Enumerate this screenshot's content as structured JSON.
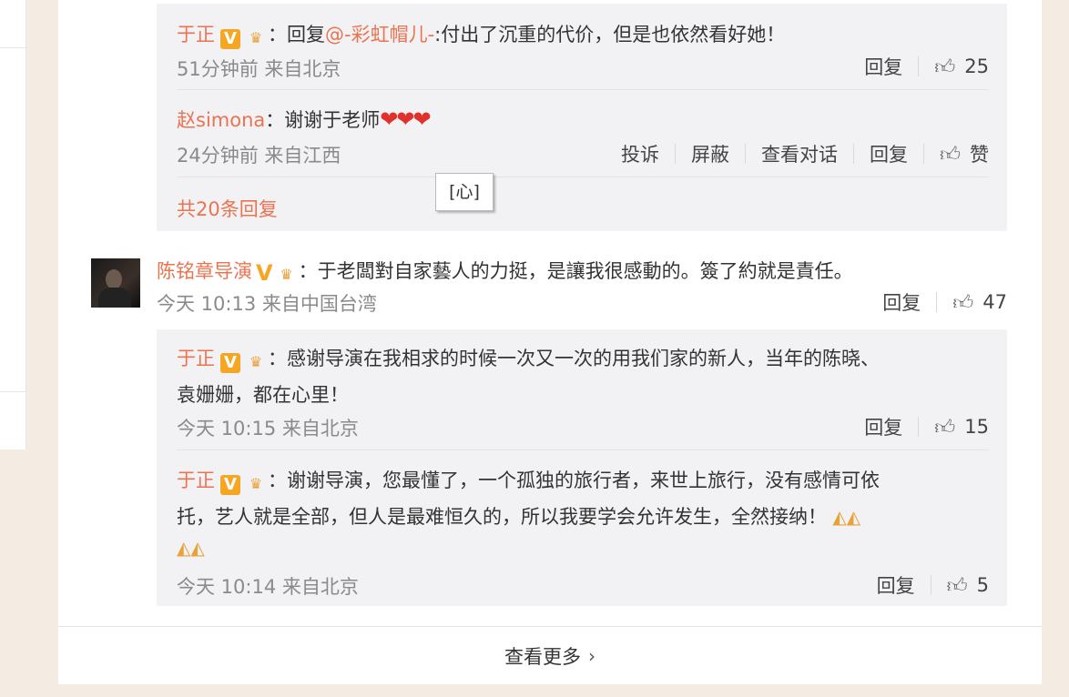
{
  "colors": {
    "name": "#eb7350",
    "badge": "#f5a623",
    "heart": "#e0312c"
  },
  "icons": [
    "v-verified-icon",
    "crown-icon",
    "thumb-up-icon",
    "chevron-right-icon",
    "prayer-hands-icon",
    "heart-icon"
  ],
  "replies_top": [
    {
      "author": "于正",
      "colon": "：",
      "reply_prefix": "回复",
      "mention": "@-彩虹帽儿-",
      "text": ":付出了沉重的代价，但是也依然看好她！",
      "time": "51分钟前 来自北京",
      "reply_label": "回复",
      "likes": "25"
    },
    {
      "author": "赵simona",
      "colon": "：",
      "text": "谢谢于老师",
      "hearts": "❤❤❤",
      "time": "24分钟前 来自江西",
      "actions": [
        "投诉",
        "屏蔽",
        "查看对话",
        "回复"
      ],
      "like_label": "赞"
    }
  ],
  "total_replies": "共20条回复",
  "tooltip": "[心]",
  "comment": {
    "author": "陈铭章导演",
    "colon": "：",
    "text": "于老闆對自家藝人的力挺，是讓我很感動的。簽了約就是責任。",
    "time": "今天 10:13 来自中国台湾",
    "reply_label": "回复",
    "likes": "47"
  },
  "replies_bottom": [
    {
      "author": "于正",
      "colon": "：",
      "text_line1": "感谢导演在我相求的时候一次又一次的用我们家的新人，当年的陈晓、",
      "text_line2": "袁姗姗，都在心里！",
      "time": "今天 10:15 来自北京",
      "reply_label": "回复",
      "likes": "15"
    },
    {
      "author": "于正",
      "colon": "：",
      "text_line1": "谢谢导演，您最懂了，一个孤独的旅行者，来世上旅行，没有感情可依",
      "text_line2": "托，艺人就是全部，但人是最难恒久的，所以我要学会允许发生，全然接纳！",
      "time": "今天 10:14 来自北京",
      "reply_label": "回复",
      "likes": "5"
    }
  ],
  "see_more": "查看更多"
}
